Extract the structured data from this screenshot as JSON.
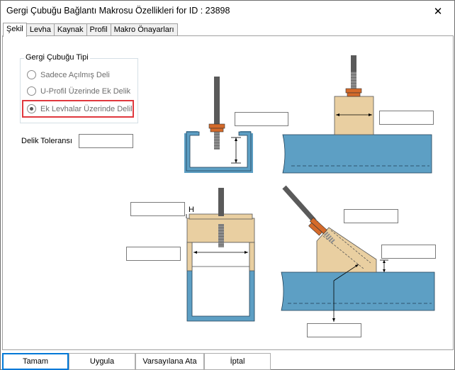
{
  "window": {
    "title": "Gergi Çubuğu Bağlantı Makrosu Özellikleri for ID : 23898",
    "close_glyph": "✕"
  },
  "tabs": [
    {
      "label": "Şekil",
      "active": true
    },
    {
      "label": "Levha",
      "active": false
    },
    {
      "label": "Kaynak",
      "active": false
    },
    {
      "label": "Profil",
      "active": false
    },
    {
      "label": "Makro Önayarları",
      "active": false
    }
  ],
  "group": {
    "title": "Gergi Çubuğu Tipi",
    "options": [
      {
        "label": "Sadece Açılmış Deli",
        "checked": false
      },
      {
        "label": "U-Profil Üzerinde Ek Delik",
        "checked": false
      },
      {
        "label": "Ek Levhalar Üzerinde Delil",
        "checked": true
      }
    ]
  },
  "tolerance": {
    "label": "Delik Toleransı",
    "value": ""
  },
  "diagram": {
    "h_label": "H",
    "fields": [
      "",
      "",
      "",
      "",
      "",
      "",
      ""
    ]
  },
  "colors": {
    "steel_blue": "#5d9fc4",
    "plate_tan": "#e9cfa1",
    "nut_orange": "#d46a2a",
    "rod_gray": "#5a5a5a",
    "highlight_red": "#e0383e",
    "default_button": "#0078d7"
  },
  "buttons": {
    "ok": "Tamam",
    "apply": "Uygula",
    "defaults": "Varsayılana Ata",
    "cancel": "İptal"
  }
}
